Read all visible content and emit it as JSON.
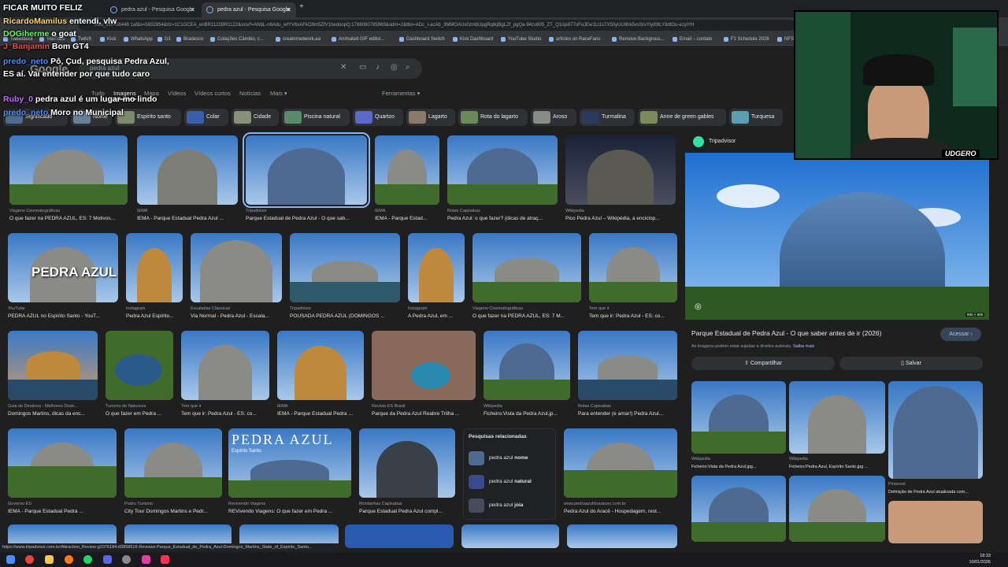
{
  "browser": {
    "tabs": [
      {
        "label": "FICAR MUITO FELIZ"
      },
      {
        "label": "pedra azul - Pesquisa Google"
      },
      {
        "label": "pedra azul - Pesquisa Google"
      }
    ],
    "new_tab": "+",
    "address": "hica_esv=56448 1af&s=5832954&rlz=1C1GCEA_enBR1122BR1122&sxsrf=ANbL-n6Adu_wfYV6xAFkO9m5ZfV1hedoopQ:1768080785969&udm=2&tbs=ADc_I-acAb_3MMOAUx0zmbUpgRq8qBgLZf_pgQa-94zv805_ZT_Q1iqs877oFoJEw1Lt1s7X50yUU8hk5vsSrvYlyit9tLY8dtOu-ezyiYH"
  },
  "bookmarks": [
    "Tweetdeck",
    "YouTube",
    "Twitch",
    "Kick",
    "WhatsApp",
    "G1",
    "Bradesco",
    "Cotações Câmbio, c...",
    "creatornetwork.ea",
    "Animated GIF editor...",
    "Dashboard Switch",
    "Kick Dashboard",
    "YouTube Studio",
    "articles on RaceFans",
    "Remove Backgrous...",
    "Email – contato",
    "F1 Schedule 2026",
    "NFS"
  ],
  "google": {
    "logo": "Google",
    "query": "pedra azul",
    "nav": [
      "Tudo",
      "Imagens",
      "Mapa",
      "Vídeos",
      "Vídeos curtos",
      "Notícias",
      "Mais ▾",
      "Ferramentas ▾"
    ],
    "chips": [
      "Significado",
      "Nome",
      "Espírito santo",
      "Colar",
      "Cidade",
      "Piscina natural",
      "Quartzo",
      "Lagarto",
      "Rota do lagarto",
      "Aroso",
      "Turmalina",
      "Anne de green gables",
      "Turquesa"
    ]
  },
  "results": [
    {
      "src": "Viagens Cinematográficas",
      "title": "O que fazer na PEDRA AZUL, ES: 7 Motivos..."
    },
    {
      "src": "IEMA",
      "title": "IEMA - Parque Estadual Pedra Azul ..."
    },
    {
      "src": "Tripadvisor",
      "title": "Parque Estadual de Pedra Azul - O que sab..."
    },
    {
      "src": "IEMA",
      "title": "IEMA - Parque Estad..."
    },
    {
      "src": "Rotas Capixabas",
      "title": "Pedra Azul: o que fazer? (dicas de atraç..."
    },
    {
      "src": "Wikipedia",
      "title": "Pico Pedra Azul – Wikipédia, a enciclop..."
    },
    {
      "src": "YouTube",
      "title": "PEDRA AZUL no Espírito Santo - YouT..."
    },
    {
      "src": "Instagram",
      "title": "Pedra Azul Espírito..."
    },
    {
      "src": "Escaladas Clássicas",
      "title": "Via Normal - Pedra Azul - Escala..."
    },
    {
      "src": "Tripadvisor",
      "title": "POUSADA PEDRA AZUL (DOMINGOS ..."
    },
    {
      "src": "Instagram",
      "title": "A Pedra Azul, em ..."
    },
    {
      "src": "Viagens Cinematográficas",
      "title": "O que fazer na PEDRA AZUL, ES: 7 M..."
    },
    {
      "src": "Tem que ir",
      "title": "Tem que ir: Pedra Azul - ES: co..."
    },
    {
      "src": "Guia de Destinos - Melhores Desti...",
      "title": "Domingos Martins, dicas da enc..."
    },
    {
      "src": "Turismo de Natureza",
      "title": "O que fazer em Pedra ..."
    },
    {
      "src": "Tem que ir",
      "title": "Tem que ir: Pedra Azul - ES: co..."
    },
    {
      "src": "IEMA",
      "title": "IEMA - Parque Estadual Pedra ..."
    },
    {
      "src": "Revista ES Brasil",
      "title": "Parque da Pedra Azul Reabre Trilha ..."
    },
    {
      "src": "Wikipedia",
      "title": "Ficheiro:Vista da Pedra Azul.jp..."
    },
    {
      "src": "Rotas Capixabas",
      "title": "Para entender (e amar!) Pedra Azul..."
    },
    {
      "src": "Governo ES",
      "title": "IEMA - Parque Estadual Pedra ..."
    },
    {
      "src": "Pratro Turismo",
      "title": "City Tour Domingos Martins e Pedr..."
    },
    {
      "src": "Revivendo Viagens",
      "title": "REVivendo Viagens: O que fazer em Pedra ..."
    },
    {
      "src": "Montanhas Capixabas",
      "title": "Parque Estadual Pedra Azul compl..."
    },
    {
      "src": "www.pedraazuldoaraceo.com.br",
      "title": "Pedra Azul do Aracê - Hospedagem, rest..."
    }
  ],
  "image_text": {
    "pedra_azul_1": "PEDRA AZUL",
    "pedra_azul_2": "PEDRA AZUL",
    "espirito_santo": "Espírito Santo"
  },
  "related": {
    "heading": "Pesquisas relacionadas",
    "items": [
      {
        "prefix": "pedra azul ",
        "bold": "nome"
      },
      {
        "prefix": "pedra azul ",
        "bold": "natural"
      },
      {
        "prefix": "pedra azul ",
        "bold": "joia"
      }
    ]
  },
  "panel": {
    "source": "Tripadvisor",
    "title": "Parque Estadual de Pedra Azul - O que saber antes de ir (2026)",
    "note": "As imagens podem estar sujeitas a direitos autorais.",
    "note_link": "Saiba mais",
    "visit": "Acessar ›",
    "share": "Compartilhar",
    "save": "Salvar",
    "dims": "900 × 900",
    "thumbs": [
      {
        "src": "Wikipedia",
        "title": "Ficheiro:Vista da Pedra Azul.jpg..."
      },
      {
        "src": "Wikipedia",
        "title": "Ficheiro:Pedra Azul, Espírito Santo.jpg ..."
      },
      {
        "src": "Pinterest",
        "title": "Definição de Pedra Azul atualizada com..."
      }
    ]
  },
  "chat": [
    {
      "user": "FICAR MUITO FELIZ",
      "msg": "",
      "color": "#ffffff"
    },
    {
      "user": "RicardoMamilus",
      "msg": "entendi, vlw",
      "color": "#ffd84a"
    },
    {
      "user": "DOGiherme",
      "msg": "o goat",
      "color": "#5cff5c"
    },
    {
      "user": "J_Banjamin",
      "msg": "Bom GT4",
      "color": "#ff4040"
    },
    {
      "user": "predo_neto",
      "msg": "Pô, Çud, pesquisa Pedra Azul, ES aí. Vai entender por que tudo caro",
      "color": "#4a8cff"
    },
    {
      "user": "Ruby_0",
      "msg": "pedra azul é um lugar mo lindo",
      "color": "#c06bff"
    },
    {
      "user": "predo_neto",
      "msg": "Moro no Municipal",
      "color": "#4a8cff"
    }
  ],
  "webcam": {
    "logo": "UDGERO"
  },
  "status_url": "https://www.tripadvisor.com.br/Attraction_Review-g1076184-d3858616-Reviews-Parque_Estadual_de_Pedra_Azul-Domingos_Martins_State_of_Espirito_Santo...",
  "clock": {
    "time": "18:33",
    "date": "10/01/2026"
  }
}
